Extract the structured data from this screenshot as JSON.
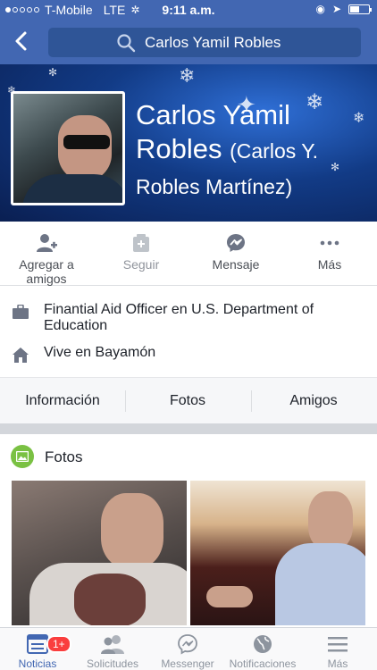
{
  "status_bar": {
    "carrier": "T-Mobile",
    "network": "LTE",
    "time": "9:11 a.m."
  },
  "header": {
    "search_text": "Carlos Yamil Robles"
  },
  "profile": {
    "name": "Carlos Yamil Robles",
    "alt_name": "(Carlos Y. Robles Martínez)"
  },
  "actions": [
    {
      "label": "Agregar a amigos",
      "icon": "add-friend-icon"
    },
    {
      "label": "Seguir",
      "icon": "follow-icon"
    },
    {
      "label": "Mensaje",
      "icon": "messenger-icon"
    },
    {
      "label": "Más",
      "icon": "more-icon"
    }
  ],
  "info": {
    "work": "Finantial Aid Officer en U.S. Department of Education",
    "home": "Vive en Bayamón"
  },
  "profile_tabs": [
    "Información",
    "Fotos",
    "Amigos"
  ],
  "photos": {
    "title": "Fotos"
  },
  "tabbar": {
    "items": [
      {
        "label": "Noticias",
        "icon": "news-feed-icon"
      },
      {
        "label": "Solicitudes",
        "icon": "friend-requests-icon"
      },
      {
        "label": "Messenger",
        "icon": "messenger-icon"
      },
      {
        "label": "Notificaciones",
        "icon": "globe-icon"
      },
      {
        "label": "Más",
        "icon": "menu-icon"
      }
    ],
    "badge": "1+"
  },
  "colors": {
    "brand": "#4267b2",
    "badge": "#fa3e3e",
    "photos_icon": "#7ac143"
  }
}
